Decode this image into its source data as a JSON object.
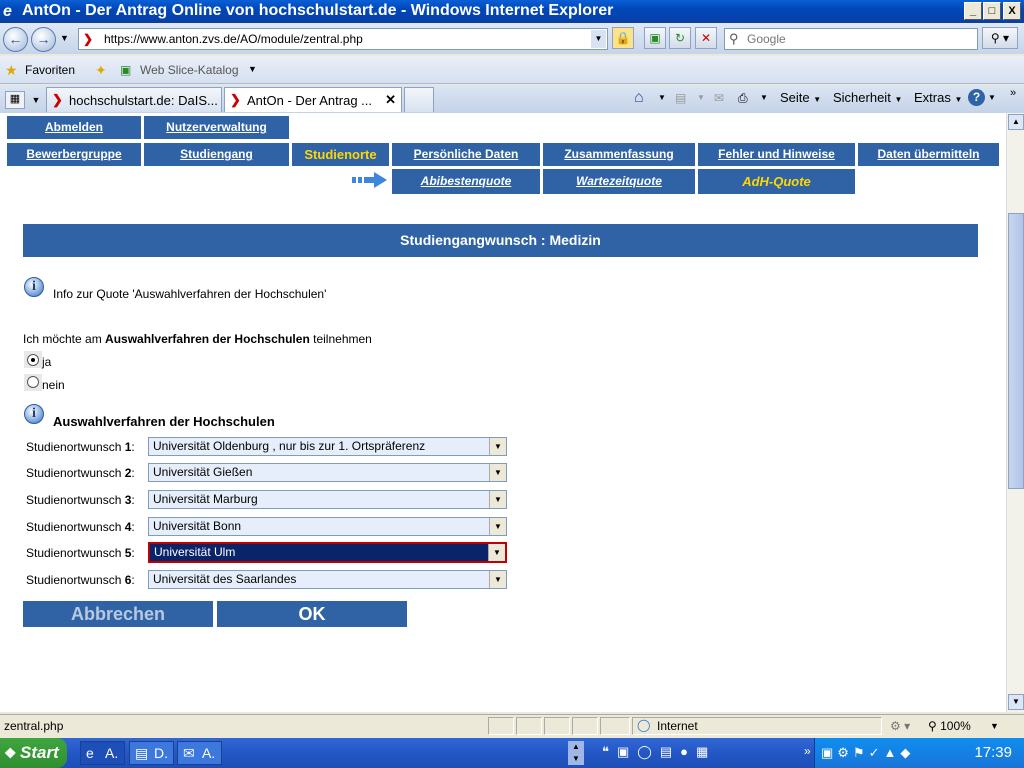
{
  "window": {
    "title": "AntOn - Der Antrag Online von hochschulstart.de - Windows Internet Explorer",
    "minimize": "_",
    "maximize": "□",
    "close": "X"
  },
  "address_bar": {
    "url": "https://www.anton.zvs.de/AO/module/zentral.php",
    "search_placeholder": "Google"
  },
  "favorites_bar": {
    "favorites_label": "Favoriten",
    "slice_label": "Web Slice-Katalog"
  },
  "tabs": [
    {
      "label": "hochschulstart.de: DaIS..."
    },
    {
      "label": "AntOn - Der Antrag ..."
    }
  ],
  "commands": {
    "page": "Seite",
    "security": "Sicherheit",
    "extras": "Extras",
    "help": "?"
  },
  "nav": {
    "row1": [
      "Abmelden",
      "Nutzerverwaltung"
    ],
    "row2": [
      "Bewerbergruppe",
      "Studiengang",
      "Studienorte",
      "Persönliche Daten",
      "Zusammenfassung",
      "Fehler und Hinweise",
      "Daten übermitteln"
    ],
    "current": "Studienorte",
    "sub": [
      "Abibestenquote",
      "Wartezeitquote",
      "AdH-Quote"
    ],
    "sub_current": "AdH-Quote"
  },
  "banner": "Studiengangwunsch : Medizin",
  "info_link": "Info zur Quote 'Auswahlverfahren der Hochschulen'",
  "participation": {
    "prefix": "Ich möchte am",
    "bold": "Auswahlverfahren der Hochschulen",
    "suffix": "teilnehmen",
    "options": [
      "ja",
      "nein"
    ],
    "selected": "ja"
  },
  "section_title": "Auswahlverfahren der Hochschulen",
  "wishes": [
    {
      "label": "Studienortwunsch",
      "num": "1",
      "value": "Universität Oldenburg , nur bis zur 1. Ortspräferenz"
    },
    {
      "label": "Studienortwunsch",
      "num": "2",
      "value": "Universität Gießen"
    },
    {
      "label": "Studienortwunsch",
      "num": "3",
      "value": "Universität Marburg"
    },
    {
      "label": "Studienortwunsch",
      "num": "4",
      "value": "Universität Bonn"
    },
    {
      "label": "Studienortwunsch",
      "num": "5",
      "value": "Universität Ulm"
    },
    {
      "label": "Studienortwunsch",
      "num": "6",
      "value": "Universität des Saarlandes"
    }
  ],
  "buttons": {
    "cancel": "Abbrechen",
    "ok": "OK"
  },
  "status": {
    "text": "zentral.php",
    "zone": "Internet",
    "zoom": "100%"
  },
  "taskbar": {
    "start": "Start",
    "items": [
      "A.",
      "D.",
      "A."
    ],
    "clock": "17:39"
  }
}
